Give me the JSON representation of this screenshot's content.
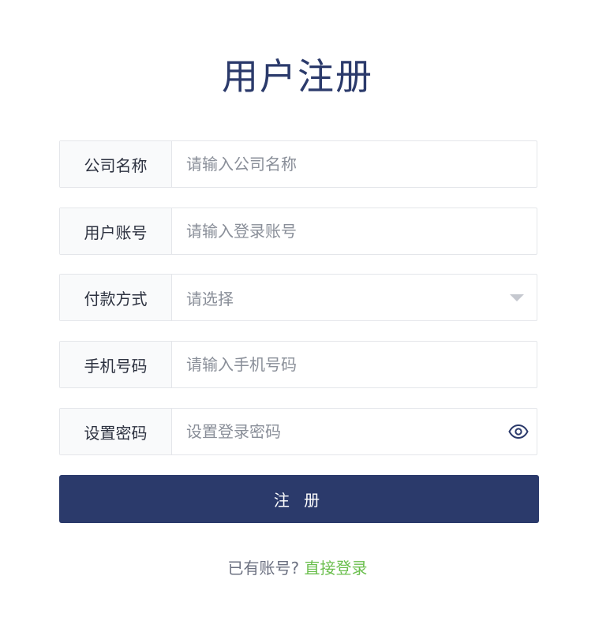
{
  "page_title": "用户注册",
  "fields": {
    "company": {
      "label": "公司名称",
      "placeholder": "请输入公司名称",
      "value": ""
    },
    "account": {
      "label": "用户账号",
      "placeholder": "请输入登录账号",
      "value": ""
    },
    "payment": {
      "label": "付款方式",
      "selected": "请选择"
    },
    "phone": {
      "label": "手机号码",
      "placeholder": "请输入手机号码",
      "value": ""
    },
    "password": {
      "label": "设置密码",
      "placeholder": "设置登录密码",
      "value": ""
    }
  },
  "icons": {
    "select_caret": "caret-down-icon",
    "password_toggle": "eye-icon"
  },
  "submit_label": "注 册",
  "footer": {
    "prompt": "已有账号?",
    "login_link": "直接登录"
  },
  "colors": {
    "primary": "#2b3a6b",
    "link": "#6bbf4e"
  }
}
